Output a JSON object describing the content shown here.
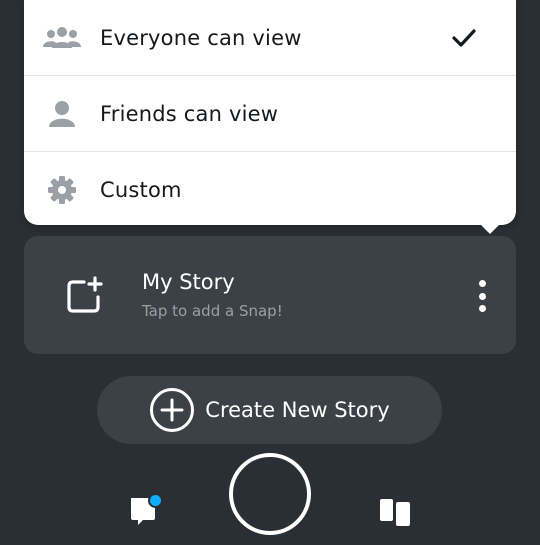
{
  "menu": {
    "items": [
      {
        "label": "Everyone can view",
        "icon": "group-icon",
        "selected": true
      },
      {
        "label": "Friends can view",
        "icon": "person-icon",
        "selected": false
      },
      {
        "label": "Custom",
        "icon": "gear-icon",
        "selected": false
      }
    ]
  },
  "story": {
    "title": "My Story",
    "subtitle": "Tap to add a Snap!",
    "add_icon": "add-story-icon",
    "more_icon": "more-vertical-icon"
  },
  "create_button": {
    "label": "Create New Story",
    "icon": "plus-circle-icon"
  },
  "bottom_nav": {
    "chat_icon": "chat-icon",
    "notification_color": "#10adff",
    "camera_button": "capture-button",
    "stories_icon": "stories-icon"
  },
  "colors": {
    "background": "#2a2f35",
    "card": "#3b4147",
    "menu_bg": "#ffffff",
    "icon_gray": "#9aa0a6"
  }
}
